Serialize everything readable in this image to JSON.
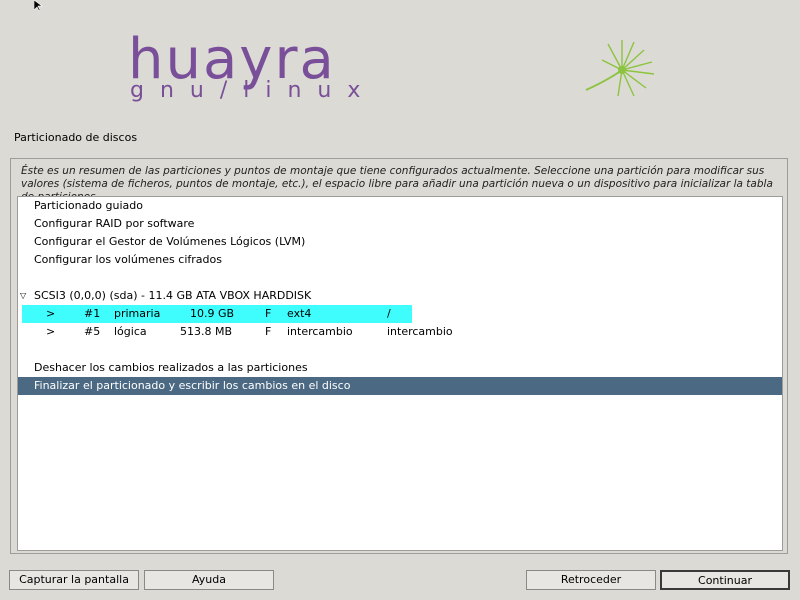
{
  "branding": {
    "logo_main": "huayra",
    "logo_sub": "gnu/linux",
    "logo_color": "#7a4f9a",
    "accent_green": "#8bc43e"
  },
  "page": {
    "title": "Particionado de discos",
    "description": "Éste es un resumen de las particiones y puntos de montaje que tiene configurados actualmente. Seleccione una partición para modificar sus valores (sistema de ficheros, puntos de montaje, etc.), el espacio libre para añadir una partición nueva o un dispositivo para inicializar la tabla de particiones."
  },
  "list": {
    "actions": [
      "Particionado guiado",
      "Configurar RAID por software",
      "Configurar el Gestor de Volúmenes Lógicos (LVM)",
      "Configurar los volúmenes cifrados"
    ],
    "disk": {
      "label": "SCSI3 (0,0,0) (sda) - 11.4 GB ATA VBOX HARDDISK",
      "expander": "▽",
      "partitions": [
        {
          "arrow": ">",
          "number": "#1",
          "type": "primaria",
          "size": "10.9 GB",
          "flag": "F",
          "fs": "ext4",
          "mount": "/",
          "selected": true
        },
        {
          "arrow": ">",
          "number": "#5",
          "type": "lógica",
          "size": "513.8 MB",
          "flag": "F",
          "fs": "intercambio",
          "mount": "intercambio",
          "selected": false
        }
      ]
    },
    "undo": "Deshacer los cambios realizados a las particiones",
    "finish": "Finalizar el particionado y escribir los cambios en el disco"
  },
  "colors": {
    "selection_cyan": "#3ffdfd",
    "selection_blue": "#4b6983",
    "window_bg": "#dcdad5"
  },
  "buttons": {
    "screenshot": "Capturar la pantalla",
    "help": "Ayuda",
    "back": "Retroceder",
    "continue": "Continuar"
  }
}
